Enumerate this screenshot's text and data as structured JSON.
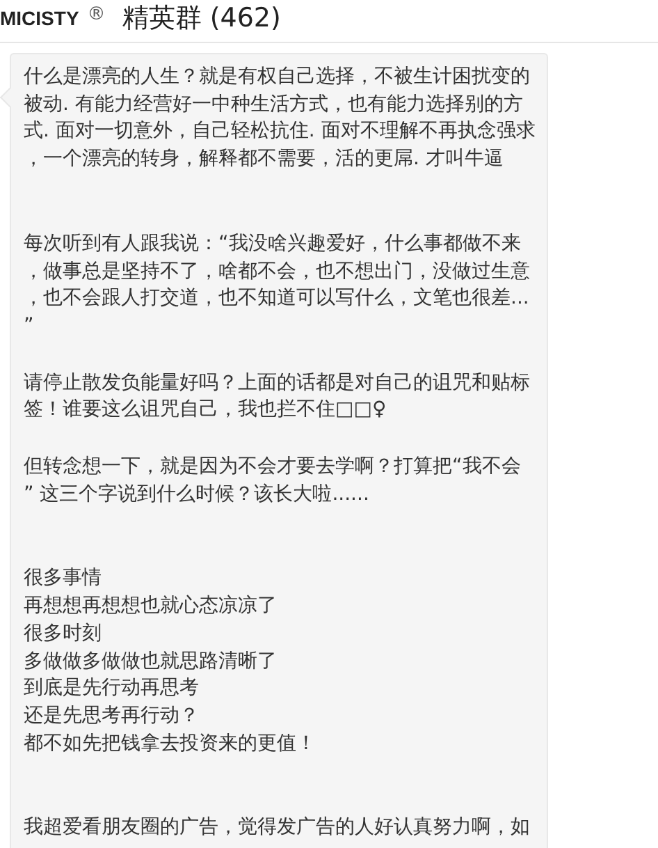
{
  "header": {
    "brand": "MICISTY",
    "registered_mark": "®",
    "group_title": "精英群 (462)"
  },
  "message": {
    "paragraphs": [
      [
        "什么是漂亮的人生？就是有权自己选择，不被生计困扰变的",
        "被动. 有能力经营好一中种生活方式，也有能力选择别的方",
        "式. 面对一切意外，自己轻松抗住. 面对不理解不再执念强求",
        "，一个漂亮的转身，解释都不需要，活的更屌. 才叫牛逼"
      ],
      [
        "每次听到有人跟我说：“我没啥兴趣爱好，什么事都做不来",
        "，做事总是坚持不了，啥都不会，也不想出门，没做过生意",
        "，也不会跟人打交道，也不知道可以写什么，文笔也很差...",
        "”"
      ],
      [
        "请停止散发负能量好吗？上面的话都是对自己的诅咒和贴标",
        "签！谁要这么诅咒自己，我也拦不住□□♀"
      ],
      [
        "但转念想一下，就是因为不会才要去学啊？打算把“我不会",
        "” 这三个字说到什么时候？该长大啦......"
      ],
      [
        "很多事情",
        "再想想再想想也就心态凉凉了",
        "很多时刻",
        "多做做多做做也就思路清晰了",
        "到底是先行动再思考",
        "还是先思考再行动？",
        "都不如先把钱拿去投资来的更值！"
      ],
      [
        "我超爱看朋友圈的广告，觉得发广告的人好认真努力啊，如"
      ]
    ]
  }
}
